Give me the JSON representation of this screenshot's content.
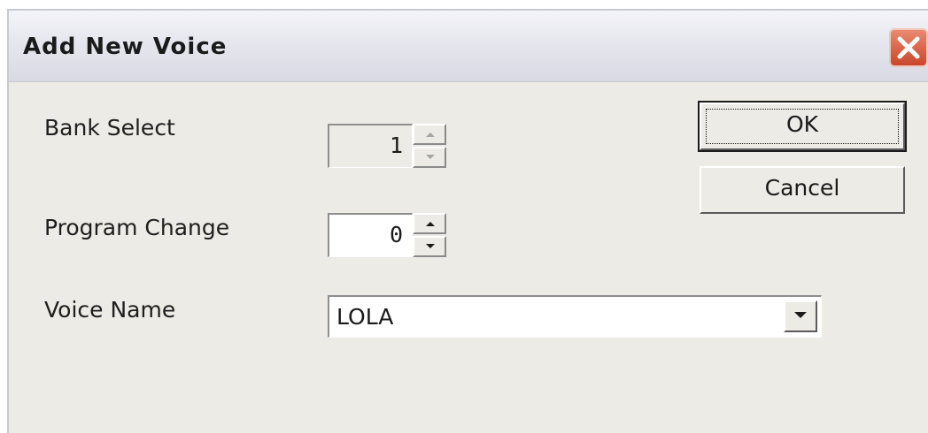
{
  "window": {
    "title": "Add New Voice"
  },
  "fields": {
    "bank_select": {
      "label": "Bank Select",
      "value": "1",
      "enabled": false
    },
    "program_change": {
      "label": "Program Change",
      "value": "0",
      "enabled": true
    },
    "voice_name": {
      "label": "Voice Name",
      "value": "LOLA"
    }
  },
  "buttons": {
    "ok": "OK",
    "cancel": "Cancel"
  },
  "icons": {
    "close": "close-icon",
    "spin_up": "arrow-up-icon",
    "spin_down": "arrow-down-icon",
    "dropdown": "chevron-down-icon"
  },
  "colors": {
    "close_button": "#c9472c",
    "dialog_face": "#ecebe5"
  }
}
